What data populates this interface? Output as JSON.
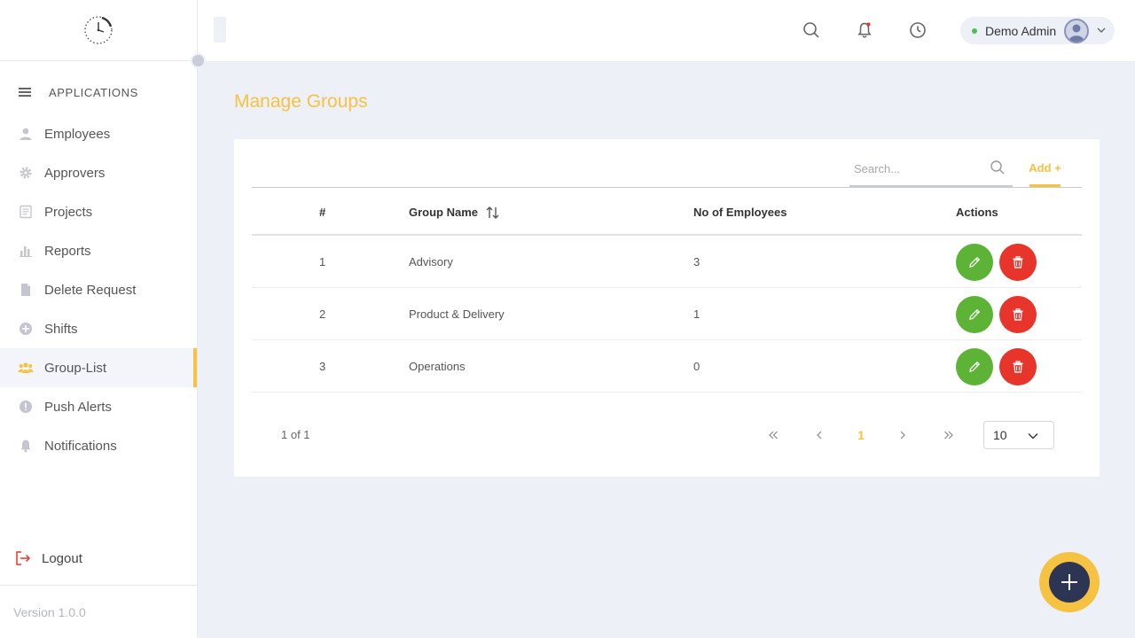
{
  "sidebar": {
    "section_label": "APPLICATIONS",
    "items": [
      {
        "label": "Employees",
        "icon": "user-icon"
      },
      {
        "label": "Approvers",
        "icon": "gear-icon"
      },
      {
        "label": "Projects",
        "icon": "document-icon"
      },
      {
        "label": "Reports",
        "icon": "bar-chart-icon"
      },
      {
        "label": "Delete Request",
        "icon": "file-icon"
      },
      {
        "label": "Shifts",
        "icon": "plus-circle-icon"
      },
      {
        "label": "Group-List",
        "icon": "group-icon",
        "active": true
      },
      {
        "label": "Push Alerts",
        "icon": "alert-circle-icon"
      },
      {
        "label": "Notifications",
        "icon": "bell-icon"
      }
    ],
    "logout_label": "Logout",
    "version": "Version 1.0.0"
  },
  "topbar": {
    "user_name": "Demo Admin",
    "user_status_color": "#4bbf4e"
  },
  "page": {
    "title": "Manage Groups"
  },
  "toolbar": {
    "search_placeholder": "Search...",
    "add_label": "Add +"
  },
  "table": {
    "columns": [
      "#",
      "Group Name",
      "No of Employees",
      "Actions"
    ],
    "rows": [
      {
        "index": "1",
        "name": "Advisory",
        "count": "3"
      },
      {
        "index": "2",
        "name": "Product & Delivery",
        "count": "1"
      },
      {
        "index": "3",
        "name": "Operations",
        "count": "0"
      }
    ]
  },
  "pagination": {
    "info": "1 of 1",
    "current_page": "1",
    "page_size": "10"
  },
  "colors": {
    "accent": "#f5c242",
    "edit": "#5cb335",
    "delete": "#e8352b",
    "fab_inner": "#2c3553"
  }
}
